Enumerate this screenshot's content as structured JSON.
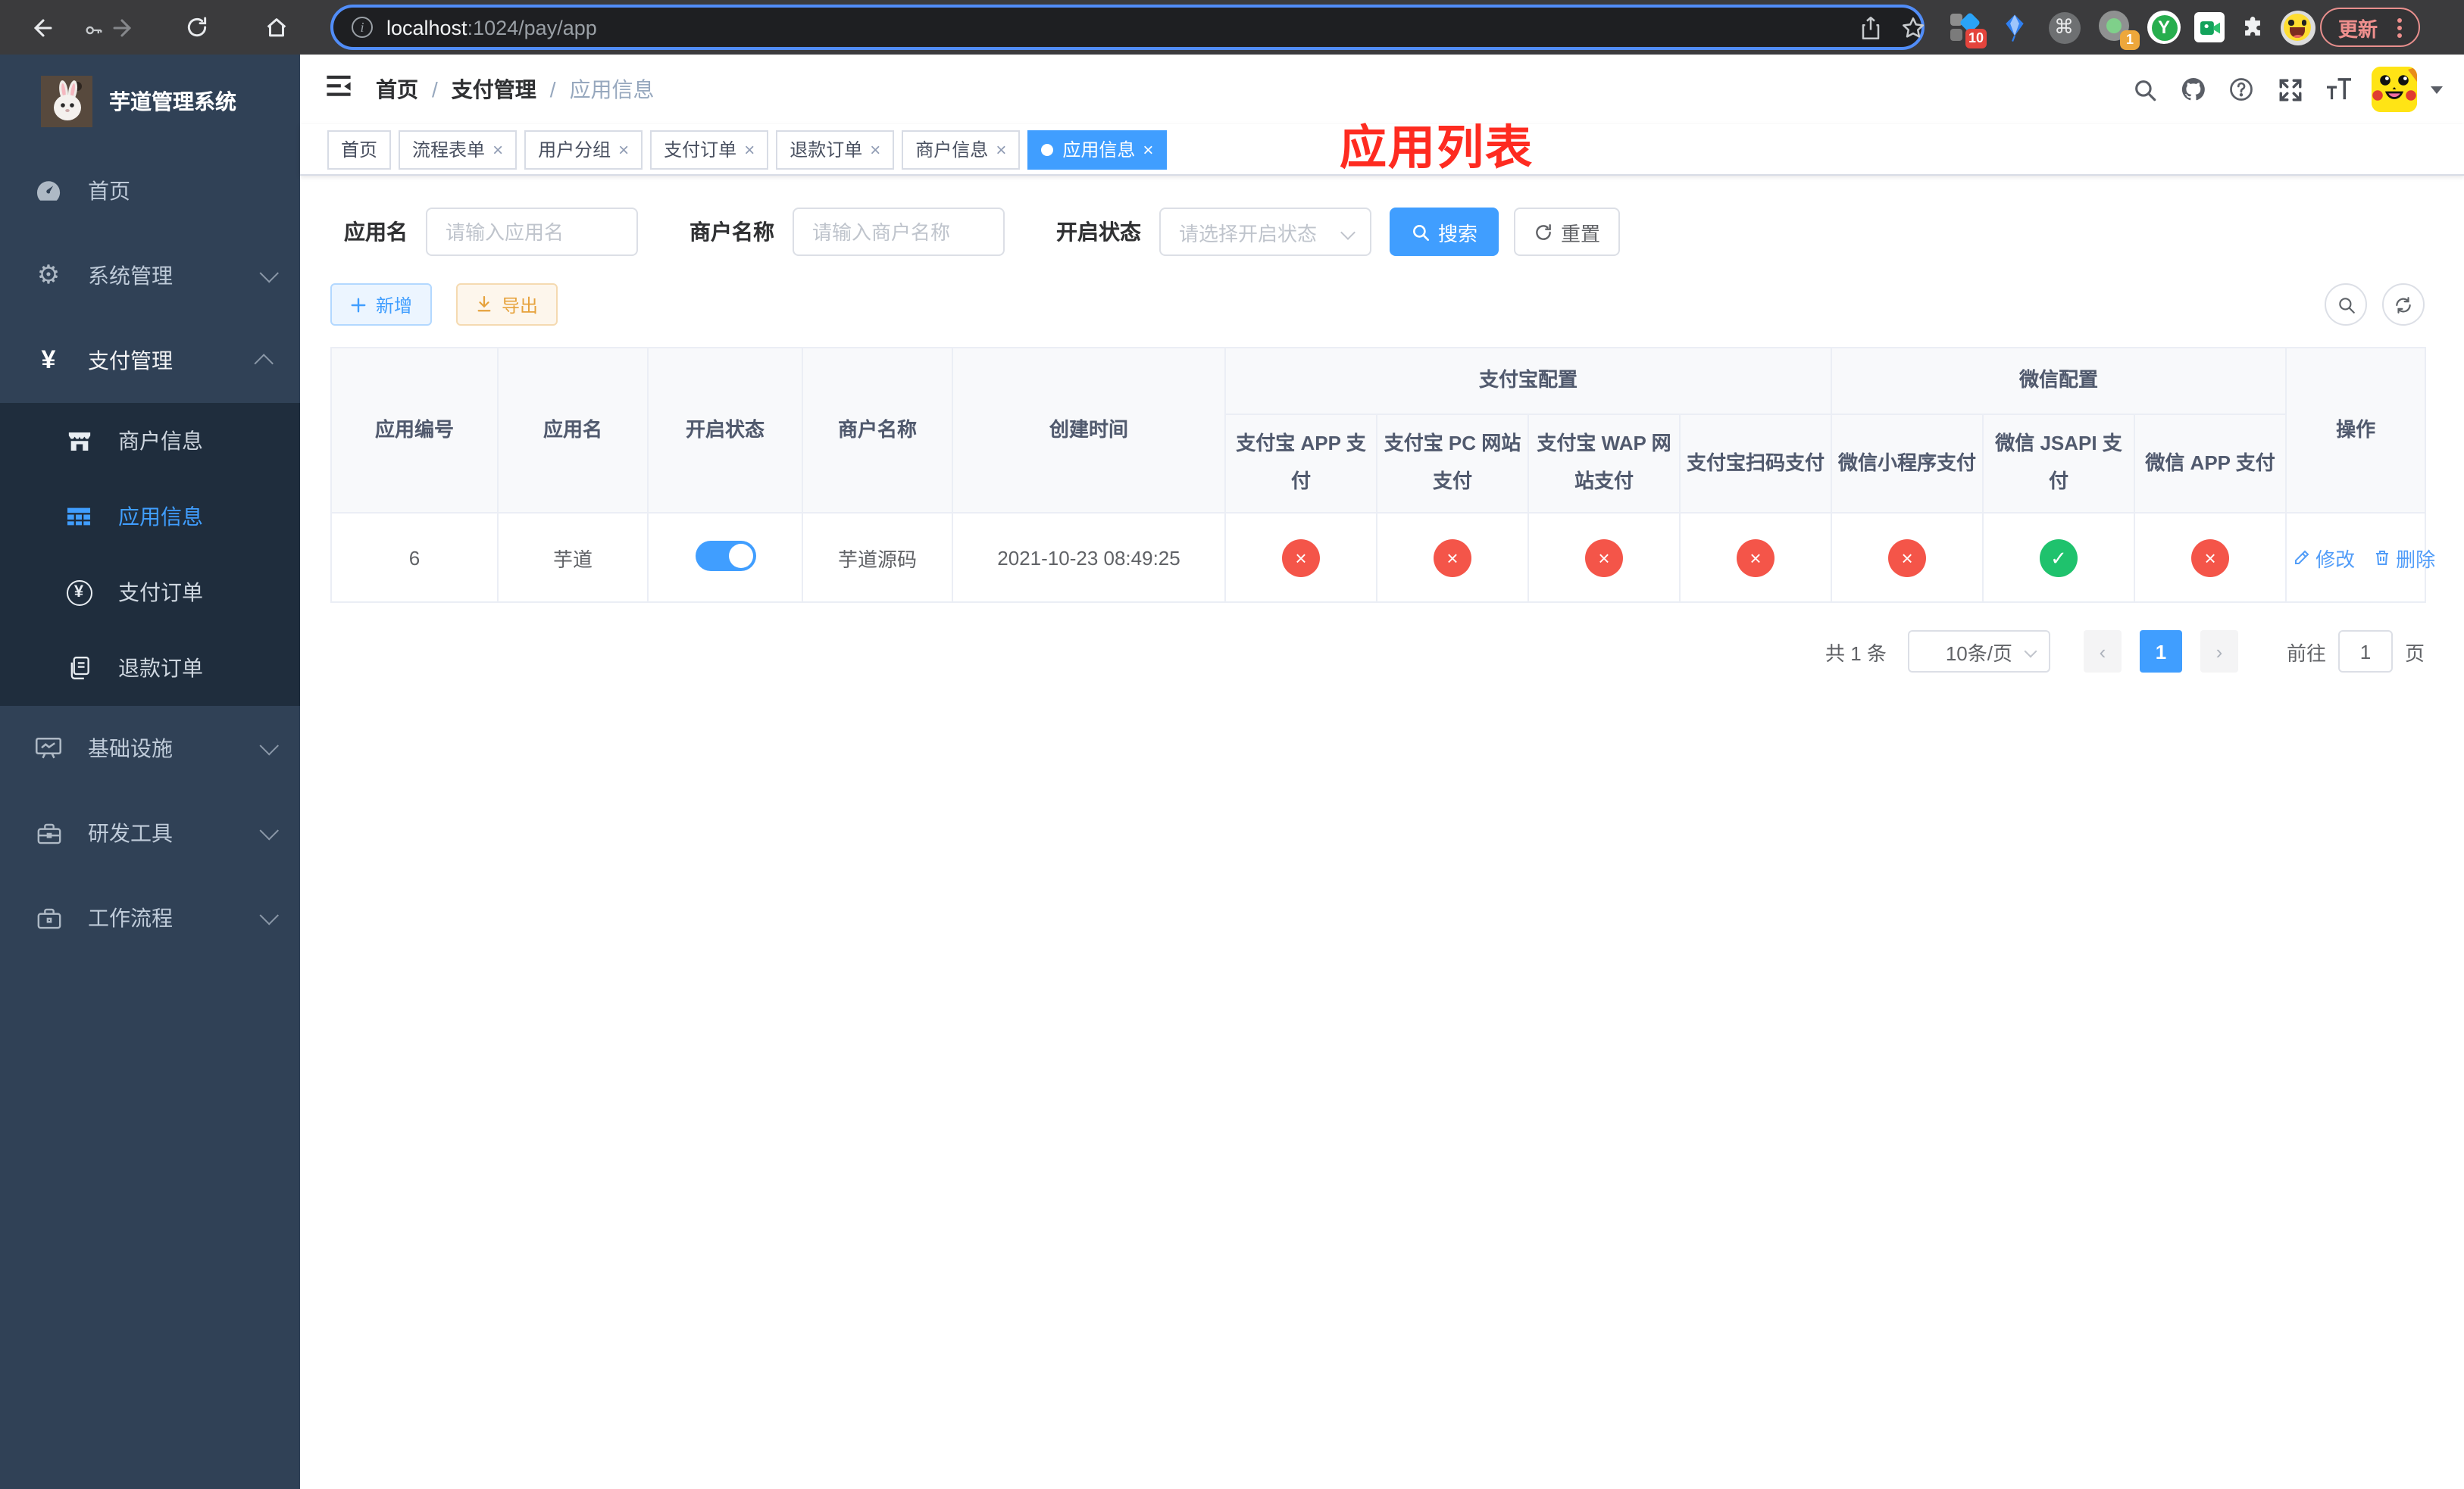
{
  "browser": {
    "url_host": "localhost",
    "url_rest": ":1024/pay/app",
    "update_label": "更新",
    "ext_badge_ten": "10",
    "ext_badge_one": "1"
  },
  "sidebar": {
    "title": "芋道管理系统",
    "items": [
      {
        "label": "首页"
      },
      {
        "label": "系统管理"
      },
      {
        "label": "支付管理",
        "children": [
          {
            "label": "商户信息"
          },
          {
            "label": "应用信息"
          },
          {
            "label": "支付订单"
          },
          {
            "label": "退款订单"
          }
        ]
      },
      {
        "label": "基础设施"
      },
      {
        "label": "研发工具"
      },
      {
        "label": "工作流程"
      }
    ]
  },
  "header": {
    "breadcrumb": [
      "首页",
      "支付管理",
      "应用信息"
    ],
    "annotation": "应用列表"
  },
  "tabs": [
    {
      "label": "首页"
    },
    {
      "label": "流程表单"
    },
    {
      "label": "用户分组"
    },
    {
      "label": "支付订单"
    },
    {
      "label": "退款订单"
    },
    {
      "label": "商户信息"
    },
    {
      "label": "应用信息"
    }
  ],
  "filters": {
    "app_name_label": "应用名",
    "app_name_placeholder": "请输入应用名",
    "merchant_label": "商户名称",
    "merchant_placeholder": "请输入商户名称",
    "status_label": "开启状态",
    "status_placeholder": "请选择开启状态",
    "search_label": "搜索",
    "reset_label": "重置"
  },
  "toolbar": {
    "add_label": "新增",
    "export_label": "导出"
  },
  "table": {
    "col_id": "应用编号",
    "col_name": "应用名",
    "col_status": "开启状态",
    "col_merchant": "商户名称",
    "col_created": "创建时间",
    "group_alipay": "支付宝配置",
    "group_wechat": "微信配置",
    "sub": [
      "支付宝 APP 支付",
      "支付宝 PC 网站支付",
      "支付宝 WAP 网站支付",
      "支付宝扫码支付",
      "微信小程序支付",
      "微信 JSAPI 支付",
      "微信 APP 支付"
    ],
    "col_action": "操作",
    "row": {
      "id": "6",
      "name": "芋道",
      "enabled": true,
      "merchant": "芋道源码",
      "created": "2021-10-23 08:49:25",
      "statuses": [
        "×",
        "×",
        "×",
        "×",
        "×",
        "✓",
        "×"
      ],
      "edit_label": "修改",
      "delete_label": "删除"
    }
  },
  "pagination": {
    "total": "共 1 条",
    "size": "10条/页",
    "page": "1",
    "goto_label": "前往",
    "goto_value": "1",
    "unit_label": "页"
  },
  "colors": {
    "accent": "#409eff",
    "danger": "#f45549",
    "success": "#1fc26d",
    "warning": "#e6a23c",
    "sidebar_bg": "#304156",
    "submenu_bg": "#1f2d3d"
  }
}
